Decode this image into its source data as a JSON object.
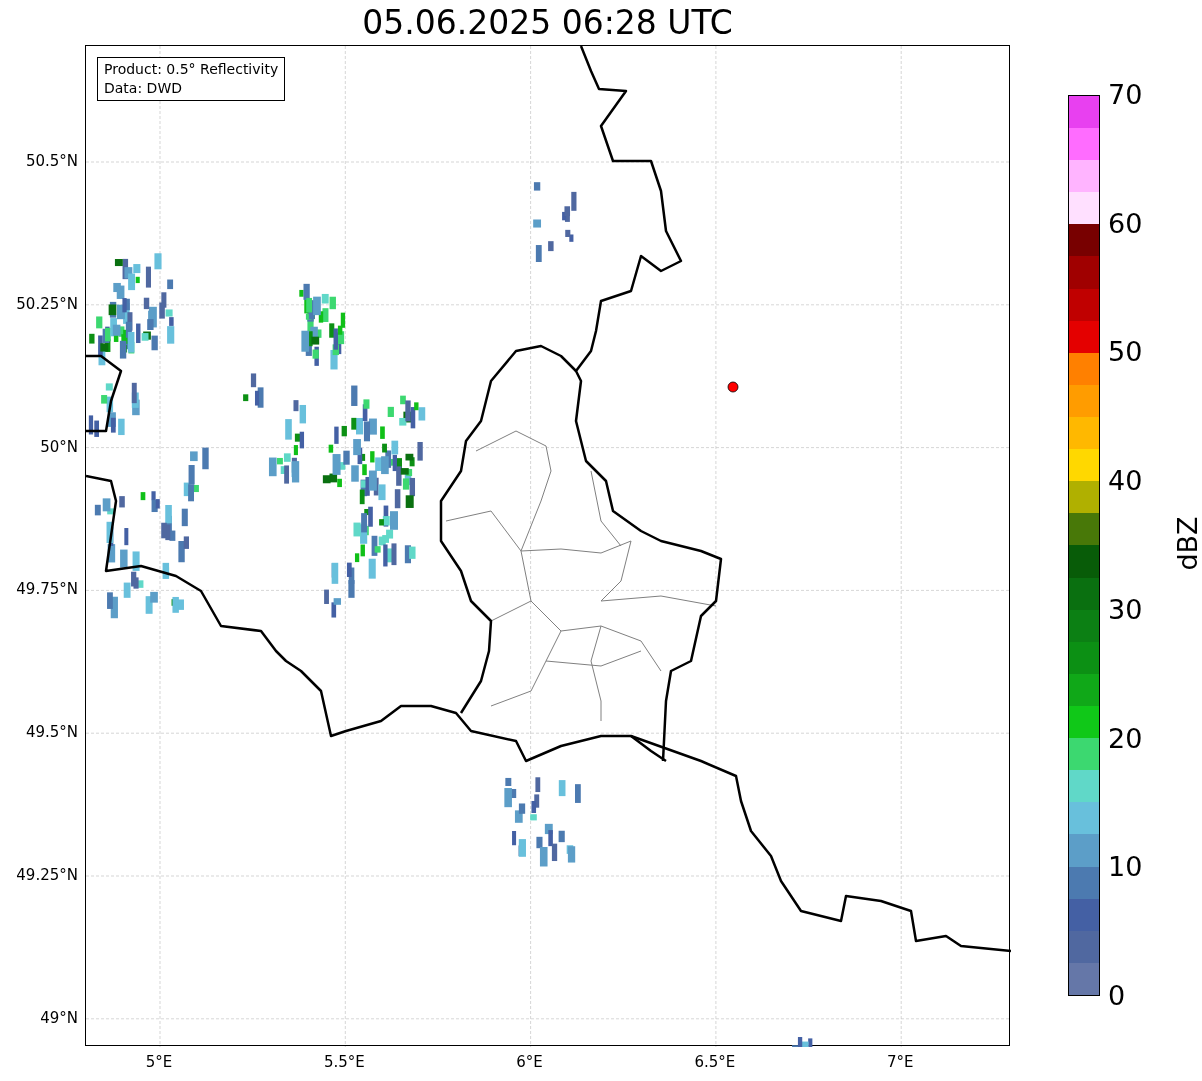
{
  "title": "05.06.2025 06:28 UTC",
  "info_box": {
    "lines": [
      "Product: 0.5° Reflectivity",
      "Data: DWD"
    ]
  },
  "map": {
    "x_ticks": [
      "5°E",
      "5.5°E",
      "6°E",
      "6.5°E",
      "7°E"
    ],
    "y_ticks": [
      "50.5°N",
      "50.25°N",
      "50°N",
      "49.75°N",
      "49.5°N",
      "49.25°N",
      "49°N"
    ]
  },
  "colorbar": {
    "label": "dBZ",
    "ticks": [
      "70",
      "60",
      "50",
      "40",
      "30",
      "20",
      "10",
      "0"
    ],
    "colors": [
      {
        "color": "#6577a8"
      },
      {
        "color": "#5068a0"
      },
      {
        "color": "#4460a4"
      },
      {
        "color": "#4c7ab0"
      },
      {
        "color": "#5c9ec8"
      },
      {
        "color": "#68c0dc"
      },
      {
        "color": "#60d8c8"
      },
      {
        "color": "#3cd870"
      },
      {
        "color": "#10c818"
      },
      {
        "color": "#10a818"
      },
      {
        "color": "#0c9014"
      },
      {
        "color": "#0c8014"
      },
      {
        "color": "#0a7010"
      },
      {
        "color": "#085c08"
      },
      {
        "color": "#487808"
      },
      {
        "color": "#b0b000"
      },
      {
        "color": "#ffd800"
      },
      {
        "color": "#ffb800"
      },
      {
        "color": "#ff9c00"
      },
      {
        "color": "#ff8000"
      },
      {
        "color": "#e40000"
      },
      {
        "color": "#c00000"
      },
      {
        "color": "#a00000"
      },
      {
        "color": "#780000"
      },
      {
        "color": "#ffe0ff"
      },
      {
        "color": "#ffb4ff"
      },
      {
        "color": "#ff6cff"
      },
      {
        "color": "#e840f0"
      }
    ]
  }
}
